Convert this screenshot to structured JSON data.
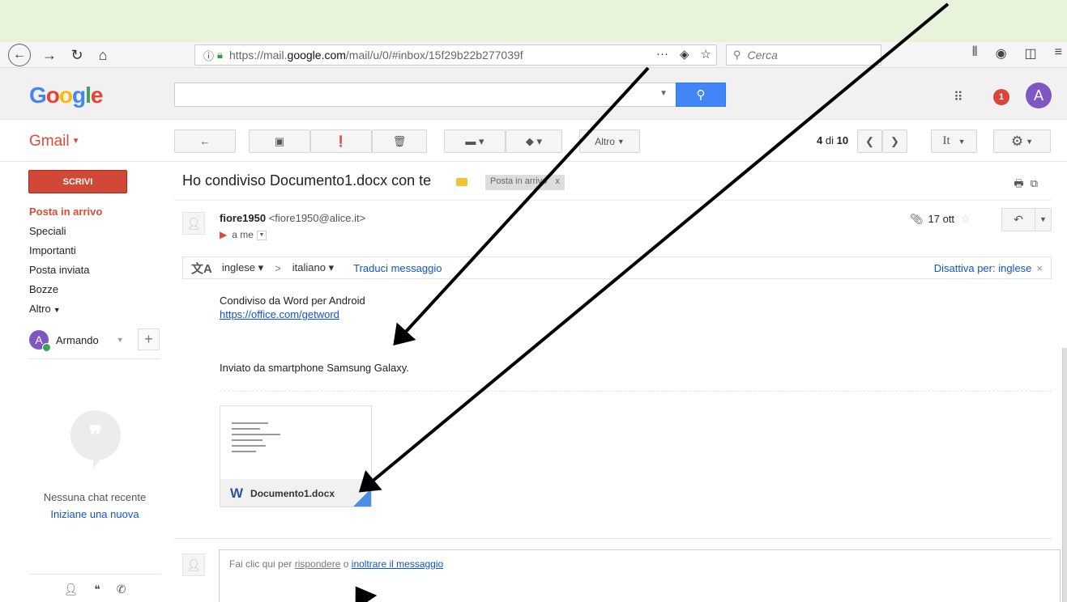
{
  "browser": {
    "url_prefix": "https://mail.",
    "url_domain": "google.com",
    "url_suffix": "/mail/u/0/#inbox/15f29b22b277039f",
    "search_placeholder": "Cerca"
  },
  "gmail": {
    "logo": [
      "G",
      "o",
      "o",
      "g",
      "l",
      "e"
    ],
    "label": "Gmail",
    "notification_count": "1",
    "avatar_letter": "A",
    "toolbar": {
      "more_label": "Altro",
      "counter_pos": "4",
      "counter_of": "di",
      "counter_total": "10",
      "lang_label": "It"
    },
    "compose_label": "SCRIVI",
    "nav": [
      "Posta in arrivo",
      "Speciali",
      "Importanti",
      "Posta inviata",
      "Bozze",
      "Altro"
    ],
    "user_name": "Armando",
    "no_chat": "Nessuna chat recente",
    "new_chat": "Iniziane una nuova"
  },
  "message": {
    "subject": "Ho condiviso Documento1.docx con te",
    "inbox_tag": "Posta in arrivo",
    "sender_name": "fiore1950",
    "sender_email": "<fiore1950@alice.it>",
    "to": "a me",
    "date": "17 ott",
    "translate": {
      "from": "inglese",
      "to": "italiano",
      "action": "Traduci messaggio",
      "disable": "Disattiva per: inglese"
    },
    "body_line1": "Condiviso da Word per Android",
    "body_link": "https://office.com/getword",
    "body_line2": "Inviato da smartphone Samsung Galaxy.",
    "attachment_name": "Documento1.docx",
    "reply_prefix": "Fai clic qui per",
    "reply_link": "rispondere",
    "reply_or": "o",
    "forward_link": "inoltrare il messaggio"
  },
  "colors": {
    "gmail_red": "#dd4b39",
    "google_blue": "#4285f4",
    "link_blue": "#15c",
    "avatar_purple": "#7e57c2",
    "page_bg": "#e8f3dc"
  }
}
